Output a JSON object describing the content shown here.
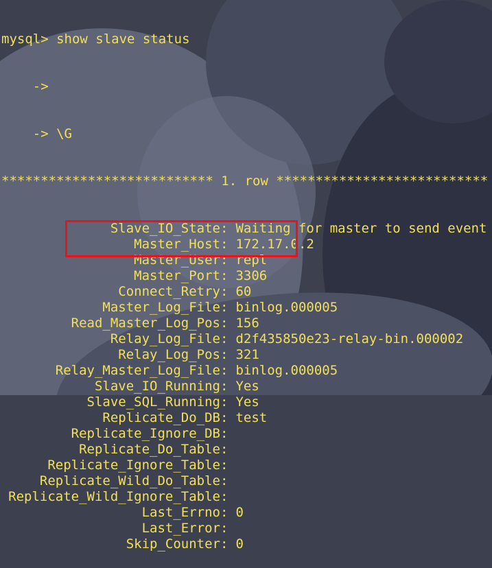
{
  "terminal": {
    "prompt": "mysql> show slave status",
    "continuation_1": "    ->",
    "continuation_2": "    -> \\G",
    "row_header": "*************************** 1. row ***************************",
    "fields": [
      {
        "key": "Slave_IO_State",
        "value": "Waiting for master to send event"
      },
      {
        "key": "Master_Host",
        "value": "172.17.0.2"
      },
      {
        "key": "Master_User",
        "value": "repl"
      },
      {
        "key": "Master_Port",
        "value": "3306"
      },
      {
        "key": "Connect_Retry",
        "value": "60"
      },
      {
        "key": "Master_Log_File",
        "value": "binlog.000005"
      },
      {
        "key": "Read_Master_Log_Pos",
        "value": "156"
      },
      {
        "key": "Relay_Log_File",
        "value": "d2f435850e23-relay-bin.000002"
      },
      {
        "key": "Relay_Log_Pos",
        "value": "321"
      },
      {
        "key": "Relay_Master_Log_File",
        "value": "binlog.000005"
      },
      {
        "key": "Slave_IO_Running",
        "value": "Yes"
      },
      {
        "key": "Slave_SQL_Running",
        "value": "Yes"
      },
      {
        "key": "Replicate_Do_DB",
        "value": "test"
      },
      {
        "key": "Replicate_Ignore_DB",
        "value": ""
      },
      {
        "key": "Replicate_Do_Table",
        "value": ""
      },
      {
        "key": "Replicate_Ignore_Table",
        "value": ""
      },
      {
        "key": "Replicate_Wild_Do_Table",
        "value": ""
      },
      {
        "key": "Replicate_Wild_Ignore_Table",
        "value": ""
      },
      {
        "key": "Last_Errno",
        "value": "0"
      },
      {
        "key": "Last_Error",
        "value": ""
      },
      {
        "key": "Skip_Counter",
        "value": "0"
      }
    ]
  },
  "colors": {
    "terminal_text": "#f2e05a",
    "highlight_border": "#e8141c"
  }
}
